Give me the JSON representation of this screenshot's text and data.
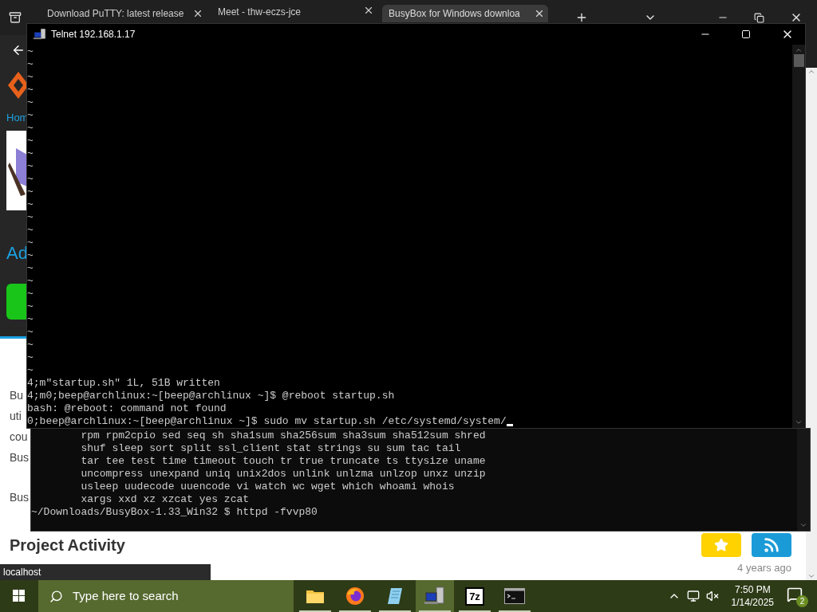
{
  "browser": {
    "tabs": [
      {
        "title": "Download PuTTY: latest release",
        "selected": false
      },
      {
        "title": "Meet - thw-eczs-jce",
        "selected": false
      },
      {
        "title": "BusyBox for Windows downloa",
        "selected": true
      }
    ],
    "page": {
      "home_link": "Hom",
      "heading": "Ad",
      "paragraphs": [
        [
          "Bu",
          "uti",
          "cou",
          "Bus"
        ],
        [
          "Bus"
        ]
      ],
      "section_title": "Project Activity",
      "timestamp": "4 years ago"
    },
    "status_url": "localhost"
  },
  "telnet": {
    "title": "Telnet 192.168.1.17",
    "tilde_lines": [
      "~",
      "~",
      "~",
      "~",
      "~",
      "~",
      "~",
      "~",
      "~",
      "~",
      "~",
      "~",
      "~",
      "~",
      "~",
      "~",
      "~",
      "~",
      "~",
      "~",
      "~",
      "~",
      "~",
      "~",
      "~",
      "~"
    ],
    "lines": [
      "4;m\"startup.sh\" 1L, 51B written",
      "4;m0;beep@archlinux:~[beep@archlinux ~]$ @reboot startup.sh",
      "bash: @reboot: command not found",
      "0;beep@archlinux:~[beep@archlinux ~]$ sudo mv startup.sh /etc/systemd/system/"
    ],
    "cursor_visible": true
  },
  "console": {
    "lines": [
      "        rpm rpm2cpio sed seq sh sha1sum sha256sum sha3sum sha512sum shred",
      "        shuf sleep sort split ssl_client stat strings su sum tac tail",
      "        tar tee test time timeout touch tr true truncate ts ttysize uname",
      "        uncompress unexpand uniq unix2dos unlink unlzma unlzop unxz unzip",
      "        usleep uudecode uuencode vi watch wc wget which whoami whois",
      "        xargs xxd xz xzcat yes zcat",
      "~/Downloads/BusyBox-1.33_Win32 $ httpd -fvvp80"
    ]
  },
  "taskbar": {
    "search_placeholder": "Type here to search",
    "apps": [
      {
        "kind": "folder",
        "selected": false
      },
      {
        "kind": "firefox",
        "selected": false
      },
      {
        "kind": "notepad",
        "selected": false
      },
      {
        "kind": "telnet",
        "selected": true
      },
      {
        "kind": "archiver",
        "label": "7z",
        "selected": false
      },
      {
        "kind": "console",
        "selected": false
      }
    ],
    "time": "7:50 PM",
    "date": "1/14/2025",
    "notification_count": "2"
  }
}
